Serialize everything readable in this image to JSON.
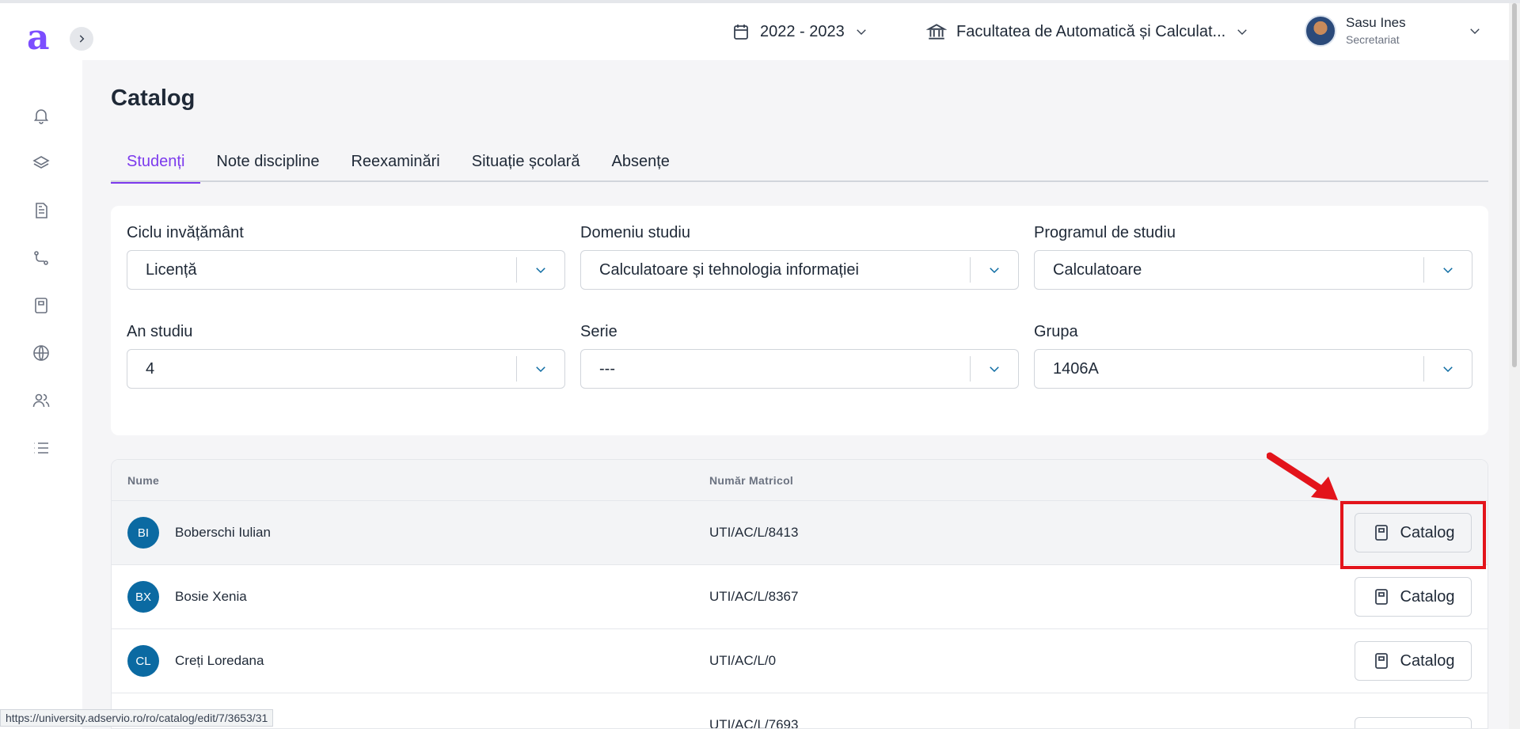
{
  "app": {
    "logo_letter": "a",
    "accent_color": "#7c3aed"
  },
  "sidebar": {
    "items": [
      {
        "icon": "bell-icon"
      },
      {
        "icon": "layers-icon"
      },
      {
        "icon": "document-icon"
      },
      {
        "icon": "route-icon"
      },
      {
        "icon": "notebook-icon"
      },
      {
        "icon": "globe-icon"
      },
      {
        "icon": "users-icon"
      },
      {
        "icon": "list-icon"
      }
    ]
  },
  "header": {
    "year": "2022 - 2023",
    "faculty": "Facultatea de Automatică și Calculat...",
    "user_name": "Sasu Ines",
    "user_role": "Secretariat"
  },
  "page": {
    "title": "Catalog"
  },
  "tabs": [
    {
      "label": "Studenți",
      "active": true
    },
    {
      "label": "Note discipline",
      "active": false
    },
    {
      "label": "Reexaminări",
      "active": false
    },
    {
      "label": "Situație școlară",
      "active": false
    },
    {
      "label": "Absențe",
      "active": false
    }
  ],
  "filters": {
    "ciclu": {
      "label": "Ciclu invățământ",
      "value": "Licență"
    },
    "domeniu": {
      "label": "Domeniu studiu",
      "value": "Calculatoare și tehnologia informației"
    },
    "program": {
      "label": "Programul de studiu",
      "value": "Calculatoare"
    },
    "an": {
      "label": "An studiu",
      "value": "4"
    },
    "serie": {
      "label": "Serie",
      "value": "---"
    },
    "grupa": {
      "label": "Grupa",
      "value": "1406A"
    }
  },
  "table": {
    "headers": {
      "name": "Nume",
      "matricol": "Număr Matricol"
    },
    "button_label": "Catalog",
    "rows": [
      {
        "initials": "BI",
        "name": "Boberschi Iulian",
        "matricol": "UTI/AC/L/8413"
      },
      {
        "initials": "BX",
        "name": "Bosie Xenia",
        "matricol": "UTI/AC/L/8367"
      },
      {
        "initials": "CL",
        "name": "Creți Loredana",
        "matricol": "UTI/AC/L/0"
      },
      {
        "initials": "",
        "name": "",
        "matricol": "UTI/AC/L/7693"
      }
    ]
  },
  "status_bar": {
    "url": "https://university.adservio.ro/ro/catalog/edit/7/3653/31"
  }
}
